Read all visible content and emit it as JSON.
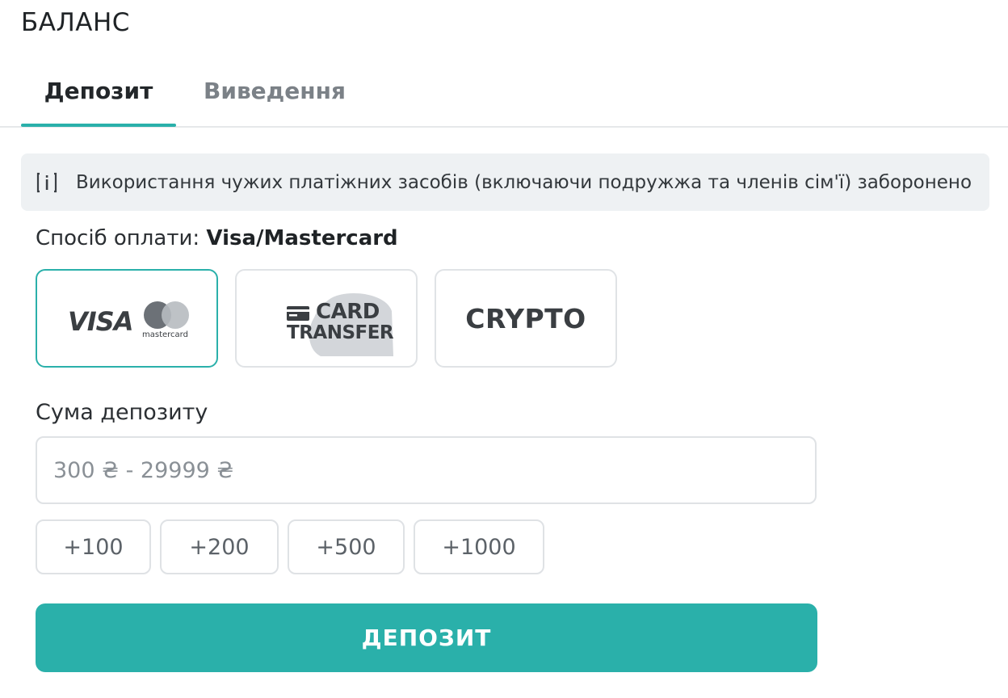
{
  "header": {
    "title": "БАЛАНС"
  },
  "tabs": [
    {
      "label": "Депозит",
      "active": true
    },
    {
      "label": "Виведення",
      "active": false
    }
  ],
  "notice": {
    "icon": "info-icon",
    "text": "Використання чужих платіжних засобів (включаючи подружжа та членів сім'ї) заборонено"
  },
  "payment": {
    "label_prefix": "Спосіб оплати:",
    "selected": "Visa/Mastercard",
    "options": [
      {
        "visa": "VISA",
        "mastercard": "mastercard",
        "selected": true
      },
      {
        "line1": "CARD",
        "line2": "TRANSFER",
        "icon": "credit-card-icon",
        "selected": false
      },
      {
        "label": "CRYPTO",
        "selected": false
      }
    ]
  },
  "amount": {
    "label": "Сума депозиту",
    "placeholder": "300 ₴ - 29999 ₴",
    "value": ""
  },
  "quick_amounts": [
    "+100",
    "+200",
    "+500",
    "+1000"
  ],
  "submit": {
    "label": "ДЕПОЗИТ"
  },
  "colors": {
    "accent": "#2ab0aa",
    "notice_bg": "#eef1f3",
    "border": "#dfe2e5"
  }
}
